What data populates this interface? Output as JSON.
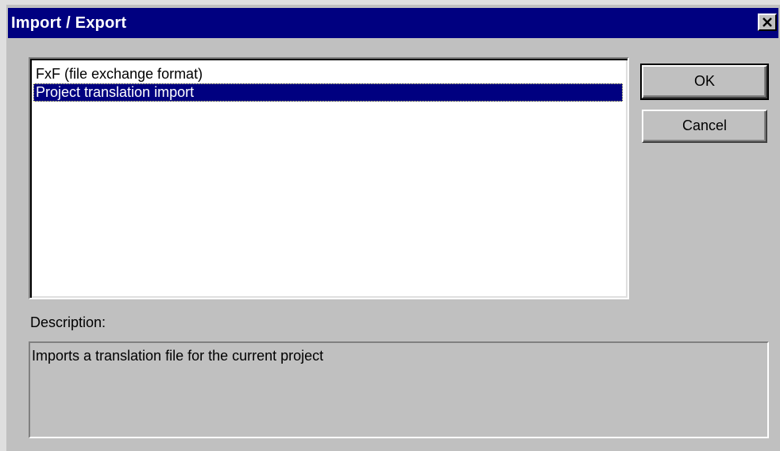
{
  "window": {
    "title": "Import / Export",
    "close_icon": "close-x-icon"
  },
  "list": {
    "items": [
      {
        "label": "FxF (file exchange format)",
        "selected": false
      },
      {
        "label": "Project translation import",
        "selected": true
      }
    ]
  },
  "buttons": {
    "ok_label": "OK",
    "cancel_label": "Cancel"
  },
  "description": {
    "label": "Description:",
    "text": "Imports a translation file for the current project"
  },
  "colors": {
    "titlebar": "#000080",
    "selection": "#000080",
    "face": "#c0c0c0"
  }
}
